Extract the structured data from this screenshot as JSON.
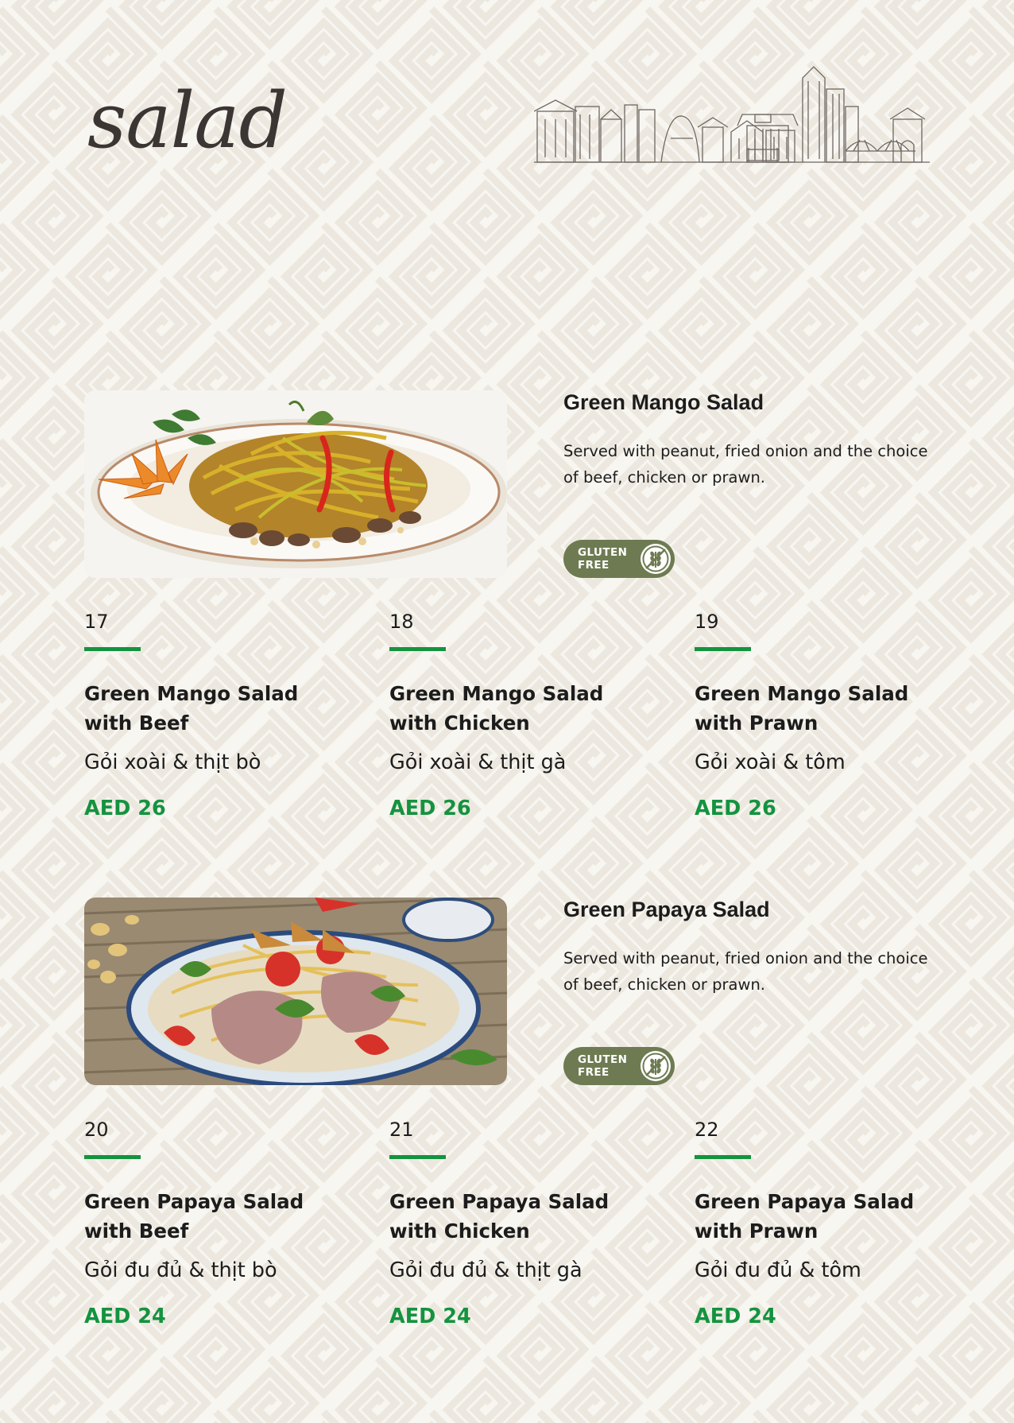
{
  "page": {
    "title": "salad",
    "accent_color": "#14933f",
    "badge_color": "#6e7b52"
  },
  "sections": [
    {
      "name": "Green Mango Salad",
      "description": "Served with peanut, fried onion and the choice of beef, chicken or prawn.",
      "photo": "green-mango-salad-photo",
      "badge": "GLUTEN FREE",
      "badge_icon": "wheat-icon",
      "variants": [
        {
          "number": "17",
          "name": "Green Mango Salad with Beef",
          "vietnamese": "Gỏi xoài & thịt bò",
          "price": "AED 26"
        },
        {
          "number": "18",
          "name": "Green Mango Salad with Chicken",
          "vietnamese": "Gỏi xoài & thịt gà",
          "price": "AED 26"
        },
        {
          "number": "19",
          "name": "Green Mango Salad with Prawn",
          "vietnamese": "Gỏi xoài & tôm",
          "price": "AED 26"
        }
      ]
    },
    {
      "name": "Green Papaya Salad",
      "description": "Served with peanut, fried onion and the choice of beef, chicken or prawn.",
      "photo": "green-papaya-salad-photo",
      "badge": "GLUTEN FREE",
      "badge_icon": "wheat-icon",
      "variants": [
        {
          "number": "20",
          "name": "Green Papaya Salad with Beef",
          "vietnamese": "Gỏi đu đủ & thịt bò",
          "price": "AED 24"
        },
        {
          "number": "21",
          "name": "Green Papaya Salad with Chicken",
          "vietnamese": "Gỏi đu đủ & thịt gà",
          "price": "AED 24"
        },
        {
          "number": "22",
          "name": "Green Papaya Salad with Prawn",
          "vietnamese": "Gỏi đu đủ & tôm",
          "price": "AED 24"
        }
      ]
    }
  ]
}
